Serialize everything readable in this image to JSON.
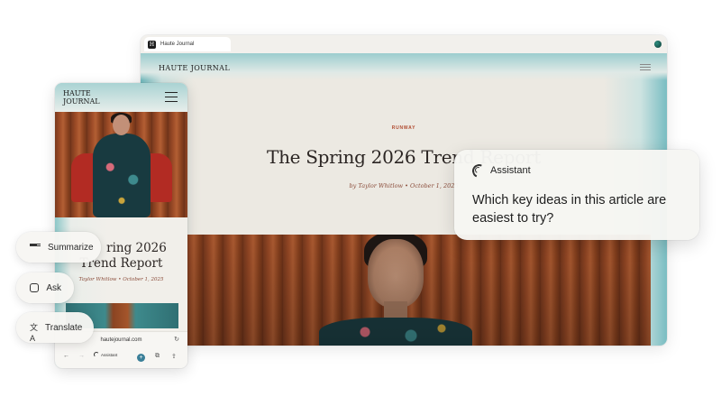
{
  "desktop": {
    "tab_title": "Haute Journal",
    "favicon_letter": "H",
    "site_logo": "HAUTE JOURNAL",
    "article": {
      "category": "RUNWAY",
      "title": "The Spring 2026 Trend Report",
      "byline": "by Taylor Whitlow • October 1, 2025"
    }
  },
  "mobile": {
    "site_logo_line1": "HAUTE",
    "site_logo_line2": "JOURNAL",
    "article_title_line1": "ring 2026",
    "article_title_line2": "Trend Report",
    "byline": "Taylor Whitlow • October 1, 2025",
    "url": "hautejournal.com",
    "toolbar": {
      "back_icon": "←",
      "forward_icon": "→",
      "assistant_label": "Assistant",
      "plus_icon": "+",
      "tabs_icon": "⧉",
      "share_icon": "⇪",
      "reload_icon": "↻"
    }
  },
  "actions": {
    "summarize": "Summarize",
    "ask": "Ask",
    "translate": "Translate",
    "translate_icon": "文A"
  },
  "assistant": {
    "label": "Assistant",
    "question": "Which key ideas in this article are easiest to try?"
  },
  "colors": {
    "accent_teal": "#6fb8bc",
    "category_red": "#b04a2f",
    "title_text": "#2b2523",
    "assistant_plus": "#3a7f98"
  }
}
